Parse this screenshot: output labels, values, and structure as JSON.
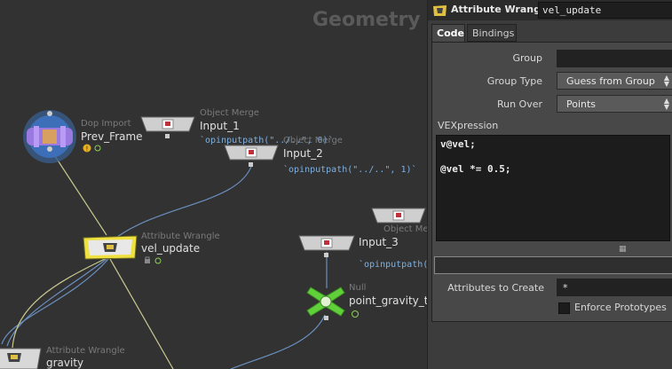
{
  "network": {
    "context_title": "Geometry",
    "nodes": {
      "prev_frame": {
        "type": "Dop Import",
        "name": "Prev_Frame"
      },
      "input_1": {
        "type": "Object Merge",
        "name": "Input_1",
        "expr": "`opinputpath(\"../..\", 0)`"
      },
      "input_2": {
        "type": "Object Merge",
        "name": "Input_2",
        "expr": "`opinputpath(\"../..\", 1)`"
      },
      "vel_update": {
        "type": "Attribute Wrangle",
        "name": "vel_update"
      },
      "input_3": {
        "type": "Object Merge",
        "name": "Input_3",
        "expr": "`opinputpath(\""
      },
      "object_merge_4": {
        "type": "Object Merge"
      },
      "point_gravity": {
        "type": "Null",
        "name": "point_gravity_ta"
      },
      "gravity": {
        "type": "Attribute Wrangle",
        "name": "gravity"
      }
    }
  },
  "parameters": {
    "node_type": "Attribute Wrangle",
    "node_name": "vel_update",
    "tabs": [
      "Code",
      "Bindings"
    ],
    "group_label": "Group",
    "group_value": "",
    "group_type_label": "Group Type",
    "group_type_value": "Guess from Group",
    "run_over_label": "Run Over",
    "run_over_value": "Points",
    "vexpression_label": "VEXpression",
    "vexpression_code": "v@vel;\n\n@vel *= 0.5;",
    "attributes_to_create_label": "Attributes to Create",
    "attributes_to_create_value": "*",
    "enforce_prototypes_label": "Enforce Prototypes"
  },
  "colors": {
    "selected_node": "#f0e040",
    "wire_blue": "#6a8fbf",
    "wire_yellow": "#c8c890",
    "null_node": "#5fcf3a",
    "dop_import": "#9a7ae0"
  }
}
